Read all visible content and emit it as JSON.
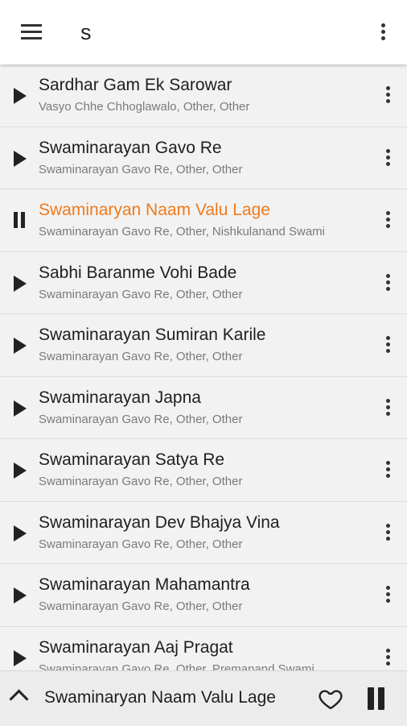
{
  "header": {
    "query": "s"
  },
  "songs": [
    {
      "title": "Sardhar Gam Ek Sarowar",
      "subtitle": "Vasyo Chhe Chhoglawalo, Other, Other",
      "playing": false
    },
    {
      "title": "Swaminarayan Gavo Re",
      "subtitle": "Swaminarayan Gavo Re, Other, Other",
      "playing": false
    },
    {
      "title": "Swaminaryan Naam Valu Lage",
      "subtitle": "Swaminarayan Gavo Re, Other, Nishkulanand Swami",
      "playing": true
    },
    {
      "title": "Sabhi Baranme Vohi Bade",
      "subtitle": "Swaminarayan Gavo Re, Other, Other",
      "playing": false
    },
    {
      "title": "Swaminarayan Sumiran Karile",
      "subtitle": "Swaminarayan Gavo Re, Other, Other",
      "playing": false
    },
    {
      "title": "Swaminarayan Japna",
      "subtitle": "Swaminarayan Gavo Re, Other, Other",
      "playing": false
    },
    {
      "title": "Swaminarayan Satya Re",
      "subtitle": "Swaminarayan Gavo Re, Other, Other",
      "playing": false
    },
    {
      "title": "Swaminarayan Dev Bhajya Vina",
      "subtitle": "Swaminarayan Gavo Re, Other, Other",
      "playing": false
    },
    {
      "title": "Swaminarayan Mahamantra",
      "subtitle": "Swaminarayan Gavo Re, Other, Other",
      "playing": false
    },
    {
      "title": "Swaminarayan Aaj Pragat",
      "subtitle": "Swaminarayan Gavo Re, Other, Premanand Swami",
      "playing": false
    }
  ],
  "player": {
    "title": "Swaminaryan Naam Valu Lage"
  },
  "colors": {
    "accent": "#f07a1a",
    "text": "#1e1e1e",
    "secondary_text": "#7a7a7a"
  },
  "icons": {
    "menu": "menu-icon",
    "overflow": "more-vert-icon",
    "play": "play-icon",
    "pause": "pause-icon",
    "favorite": "heart-icon",
    "expand": "chevron-up-icon"
  }
}
